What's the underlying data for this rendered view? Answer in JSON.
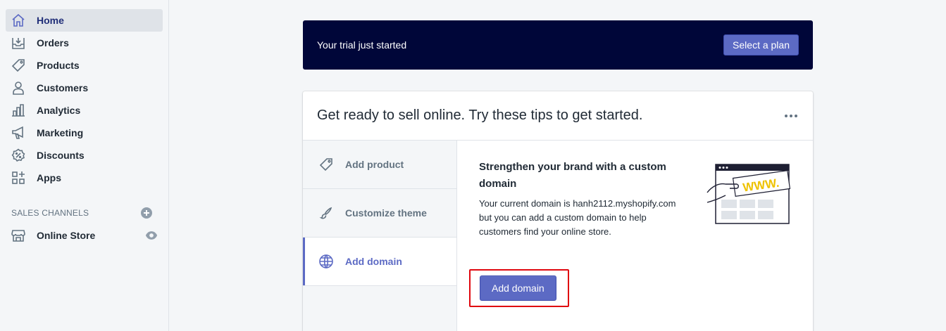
{
  "sidebar": {
    "items": [
      {
        "label": "Home",
        "icon": "home-icon",
        "active": true
      },
      {
        "label": "Orders",
        "icon": "orders-icon"
      },
      {
        "label": "Products",
        "icon": "tag-icon"
      },
      {
        "label": "Customers",
        "icon": "person-icon"
      },
      {
        "label": "Analytics",
        "icon": "bar-chart-icon"
      },
      {
        "label": "Marketing",
        "icon": "megaphone-icon"
      },
      {
        "label": "Discounts",
        "icon": "discount-icon"
      },
      {
        "label": "Apps",
        "icon": "apps-icon"
      }
    ],
    "sales_channels": {
      "title": "SALES CHANNELS",
      "add_icon": "plus-circle-icon",
      "items": [
        {
          "label": "Online Store",
          "icon": "store-icon",
          "trailing_icon": "eye-icon"
        }
      ]
    }
  },
  "trial": {
    "text": "Your trial just started",
    "button": "Select a plan"
  },
  "tips_card": {
    "title": "Get ready to sell online. Try these tips to get started.",
    "more_icon": "more-horizontal-icon",
    "tabs": [
      {
        "label": "Add product",
        "icon": "tag-icon"
      },
      {
        "label": "Customize theme",
        "icon": "brush-icon"
      },
      {
        "label": "Add domain",
        "icon": "globe-icon",
        "active": true
      }
    ],
    "panel": {
      "heading": "Strengthen your brand with a custom domain",
      "body": "Your current domain is hanh2112.myshopify.com but you can add a custom domain to help customers find your online store.",
      "button": "Add domain",
      "illustration_text": "WWW."
    }
  },
  "colors": {
    "accent": "#5c6ac4",
    "banner": "#000639",
    "highlight": "#e0070f",
    "sidebar_active": "#202e78"
  }
}
